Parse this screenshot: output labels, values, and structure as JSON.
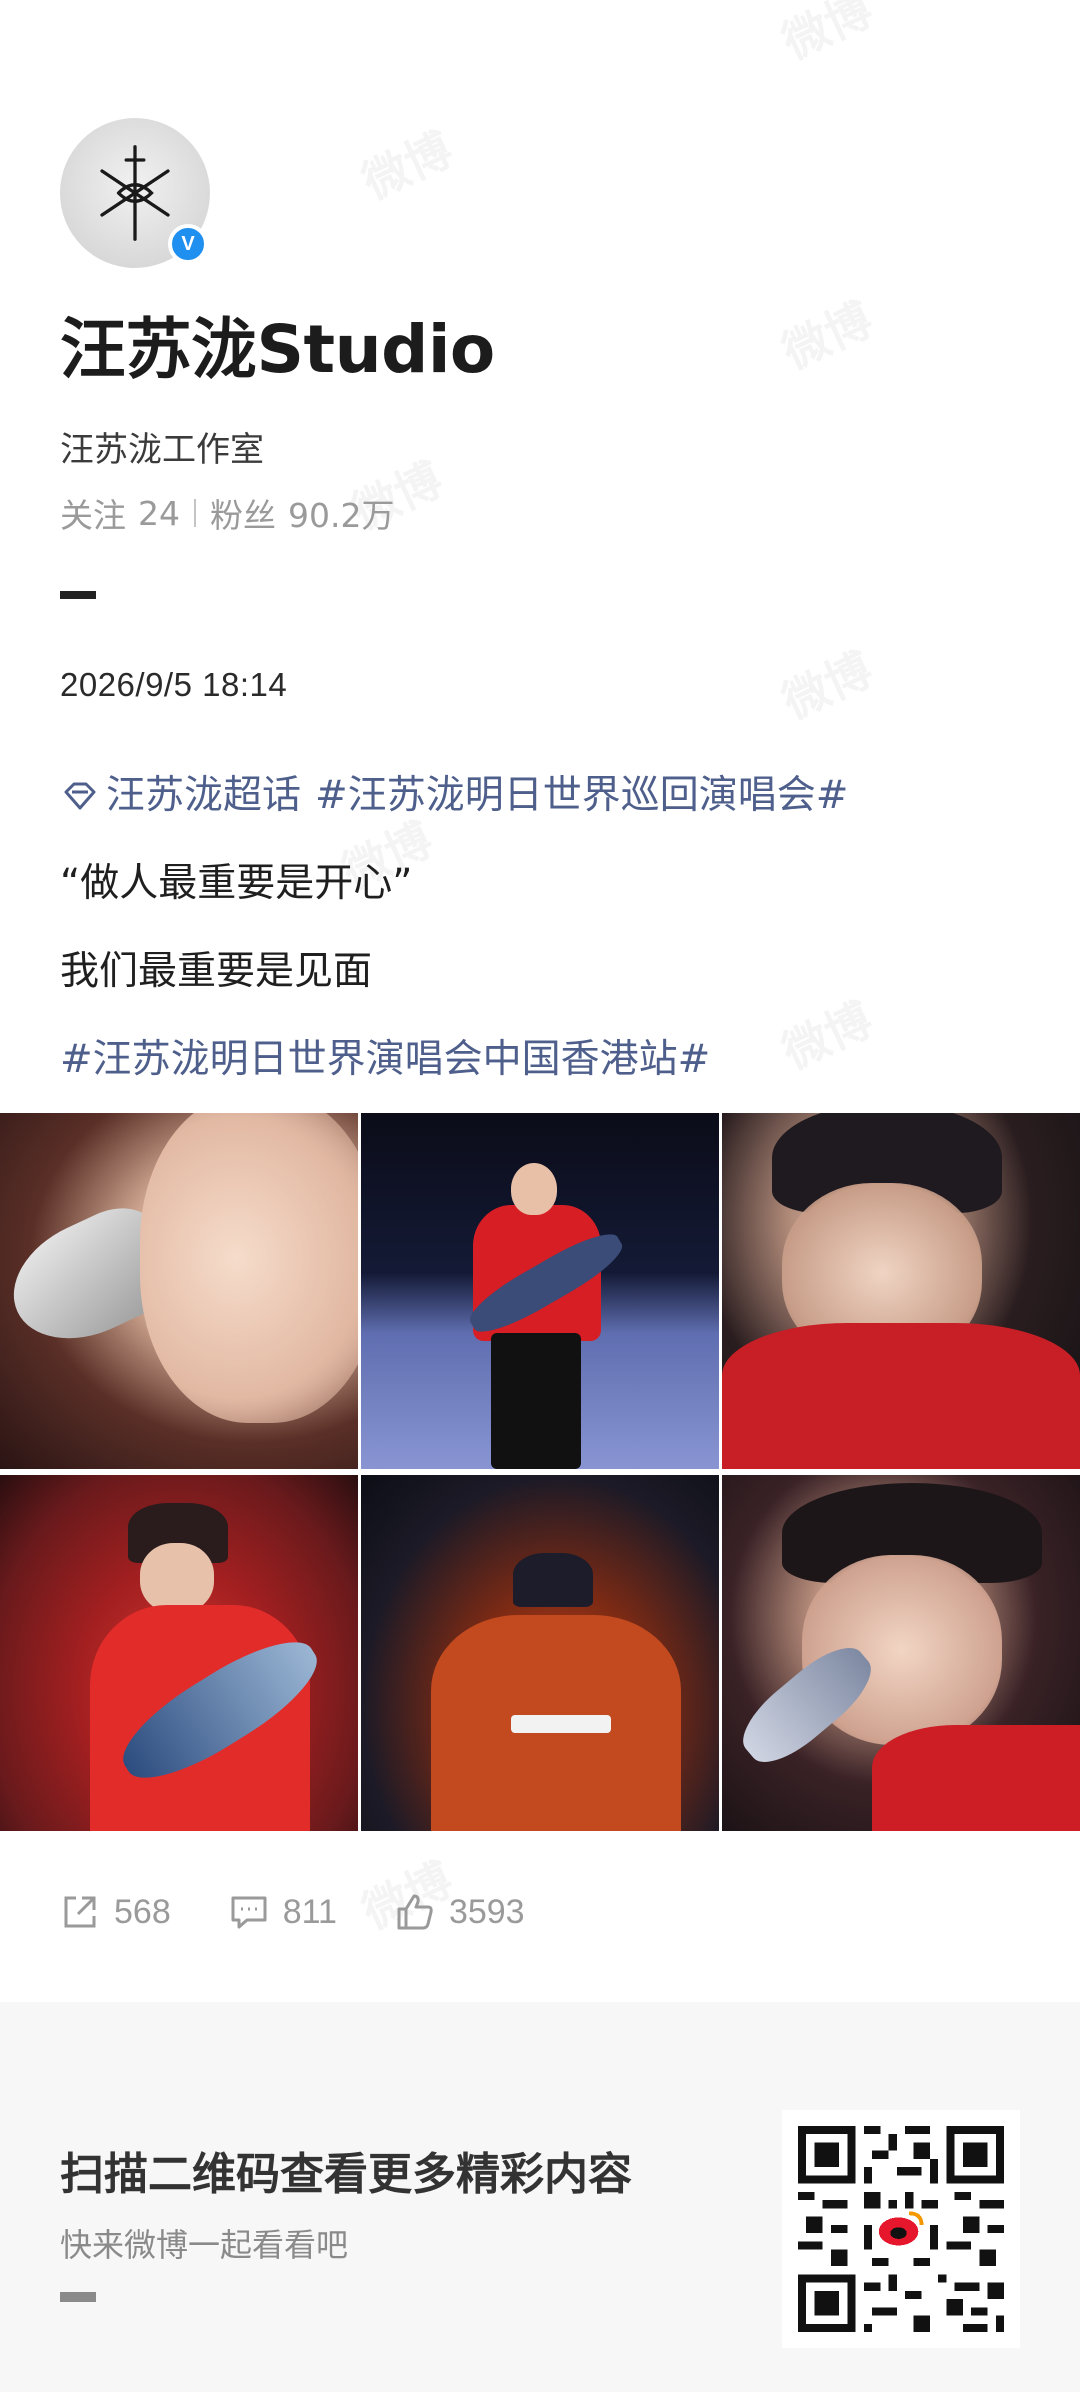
{
  "profile": {
    "name": "汪苏泷Studio",
    "subname": "汪苏泷工作室",
    "following_label": "关注",
    "following_count": "24",
    "followers_label": "粉丝",
    "followers_count": "90.2万"
  },
  "post": {
    "date": "2026/9/5 18:14",
    "super_topic": "汪苏泷超话",
    "topic_1": "#汪苏泷明日世界巡回演唱会#",
    "line_1": "“做人最重要是开心”",
    "line_2": "我们最重要是见面",
    "topic_2": "#汪苏泷明日世界演唱会中国香港站#",
    "photos": [
      "photo-1",
      "photo-2",
      "photo-3",
      "photo-4",
      "photo-5",
      "photo-6"
    ]
  },
  "actions": {
    "shares": "568",
    "comments": "811",
    "likes": "3593"
  },
  "footer": {
    "title": "扫描二维码查看更多精彩内容",
    "subtitle": "快来微博一起看看吧"
  },
  "watermark_text": "微博",
  "colors": {
    "topic": "#4f5f8c",
    "verified": "#1f8ff0",
    "muted": "#9a9a9a"
  }
}
